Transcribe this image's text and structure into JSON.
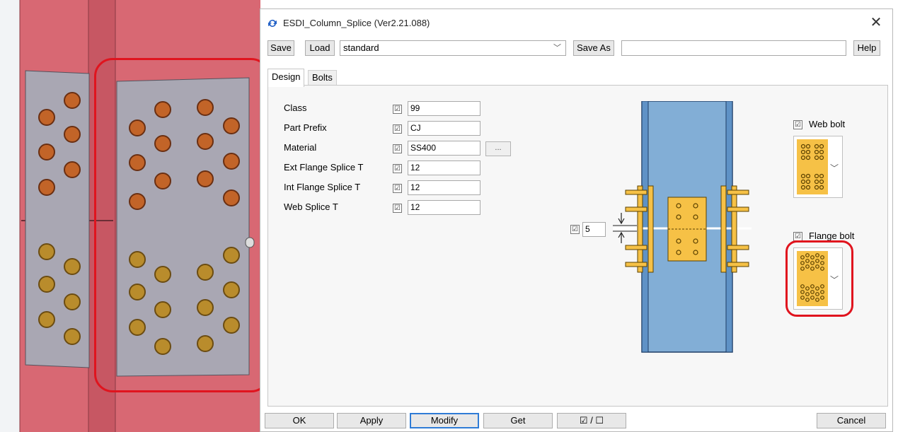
{
  "window": {
    "title": "ESDI_Column_Splice (Ver2.21.088)",
    "close_glyph": "✕"
  },
  "toolbar": {
    "save_label": "Save",
    "load_label": "Load",
    "preset_value": "standard",
    "save_as_label": "Save As",
    "save_as_value": "",
    "help_label": "Help"
  },
  "tabs": [
    {
      "label": "Design",
      "active": true
    },
    {
      "label": "Bolts",
      "active": false
    }
  ],
  "design": {
    "rows": [
      {
        "label": "Class",
        "checked": true,
        "value": "99"
      },
      {
        "label": "Part Prefix",
        "checked": true,
        "value": "CJ"
      },
      {
        "label": "Material",
        "checked": true,
        "value": "SS400",
        "browse_label": "..."
      },
      {
        "label": "Ext Flange Splice T",
        "checked": true,
        "value": "12"
      },
      {
        "label": "Int Flange Splice T",
        "checked": true,
        "value": "12"
      },
      {
        "label": "Web Splice T",
        "checked": true,
        "value": "12"
      }
    ],
    "gap_value": "5",
    "web_bolt_label": "Web bolt",
    "flange_bolt_label": "Flange bolt",
    "check_glyph": "☑"
  },
  "bottom": {
    "ok_label": "OK",
    "apply_label": "Apply",
    "modify_label": "Modify",
    "get_label": "Get",
    "toggle_label": "☑ / ☐",
    "cancel_label": "Cancel"
  },
  "colors": {
    "column_steel": "#d86873",
    "splice_plate": "#a9a7b3",
    "bolt": "#b85a2a",
    "diagram_column": "#82aed6",
    "diagram_plate": "#f6c146",
    "highlight": "#e0141e",
    "focus_border": "#2f7cd6"
  },
  "icons": [
    "app-logo-icon",
    "close-icon",
    "dropdown-arrow-icon",
    "checkbox-icon",
    "chevron-down-icon"
  ]
}
